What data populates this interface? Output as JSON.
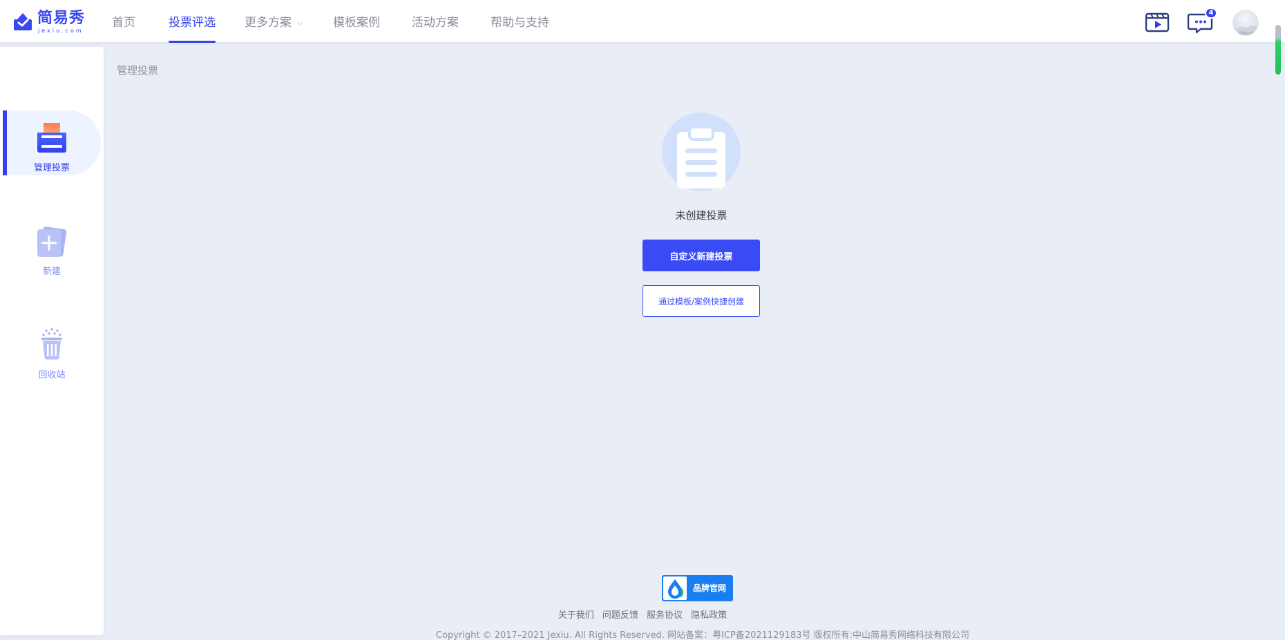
{
  "header": {
    "logo_text": "简易秀",
    "logo_sub": "jexiu.com",
    "nav": [
      {
        "label": "首页"
      },
      {
        "label": "投票评选"
      },
      {
        "label": "更多方案"
      },
      {
        "label": "模板案例"
      },
      {
        "label": "活动方案"
      },
      {
        "label": "帮助与支持"
      }
    ],
    "active_nav": "投票评选",
    "message_count": "4",
    "icons": [
      "video-tutorial-icon",
      "message-icon",
      "avatar"
    ]
  },
  "sidebar": {
    "items": [
      {
        "label": "管理投票",
        "icon": "ballot-box-icon",
        "active": true
      },
      {
        "label": "新建",
        "icon": "new-card-icon",
        "active": false
      },
      {
        "label": "回收站",
        "icon": "trash-icon",
        "active": false
      }
    ]
  },
  "main": {
    "breadcrumb": "管理投票",
    "empty_state_icon": "clipboard-icon",
    "empty_text": "未创建投票",
    "primary_button": "自定义新建投票",
    "secondary_button": "通过模板/案例快捷创建"
  },
  "footer": {
    "brand_badge": "品牌官网",
    "links": [
      "关于我们",
      "问题反馈",
      "服务协议",
      "隐私政策"
    ],
    "copyright": "Copyright © 2017–2021 Jexiu. All Rights Reserved. 网站备案：粤ICP备2021129183号 版权所有:中山简易秀网络科技有限公司"
  },
  "colors": {
    "accent": "#3441e8",
    "page_bg": "#e9edf6",
    "sidebar_active_bg": "#edf4ff",
    "brand_badge": "#1a7ef0"
  }
}
